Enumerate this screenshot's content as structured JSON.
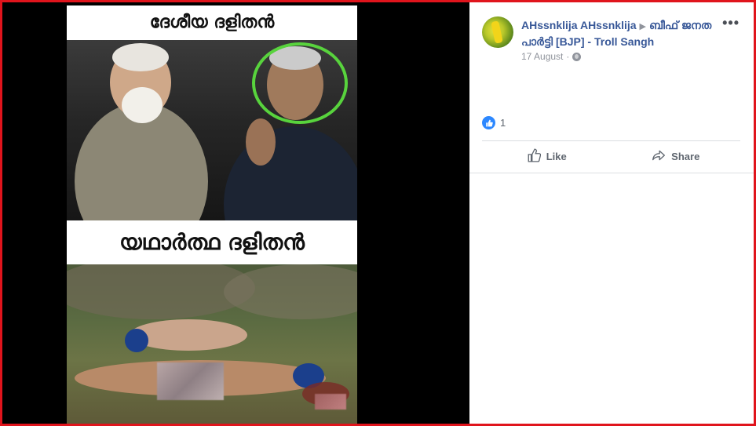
{
  "meme": {
    "caption_top": "ദേശീയ ദളിതൻ",
    "caption_middle": "യഥാർത്ഥ ദളിതൻ",
    "highlight_color": "#58d33d"
  },
  "post": {
    "author": "AHssnklija AHssnklija",
    "group": "ബീഫ് ജനത പാർട്ടി [BJP] - Troll Sangh",
    "date": "17 August",
    "privacy_icon": "globe-icon",
    "more_label": "•••",
    "reaction_count": "1",
    "actions": {
      "like_label": "Like",
      "share_label": "Share"
    }
  },
  "colors": {
    "frame": "#e0141c",
    "link": "#385898",
    "muted": "#90949c",
    "like_blue": "#2d88ff"
  }
}
